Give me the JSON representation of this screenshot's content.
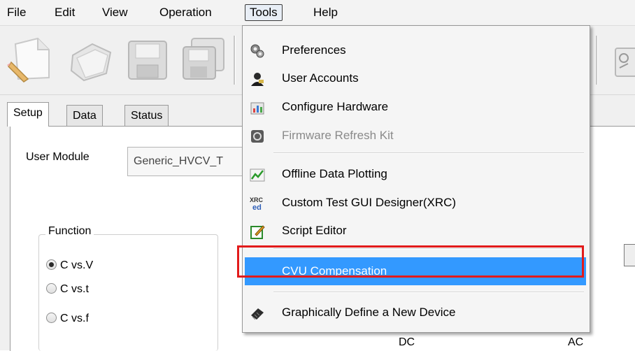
{
  "menubar": {
    "items": [
      "File",
      "Edit",
      "View",
      "Operation",
      "Tools",
      "Help"
    ],
    "active": "Tools"
  },
  "toolbar": {
    "icons": [
      "new-document-icon",
      "open-folder-icon",
      "save-icon",
      "save-all-icon",
      "settings-icon"
    ]
  },
  "tabs": [
    "Setup",
    "Data",
    "Status"
  ],
  "setup": {
    "user_module_label": "User Module",
    "user_module_value": "Generic_HVCV_T",
    "function_group_title": "Function",
    "function_options": [
      "C vs.V",
      "C vs.t",
      "C vs.f"
    ],
    "function_selected": "C vs.V",
    "dc_label": "DC",
    "ac_label": "AC"
  },
  "tools_menu": {
    "items": [
      {
        "label": "Preferences",
        "icon": "preferences-icon",
        "enabled": true
      },
      {
        "label": "User Accounts",
        "icon": "user-accounts-icon",
        "enabled": true
      },
      {
        "label": "Configure Hardware",
        "icon": "configure-hardware-icon",
        "enabled": true
      },
      {
        "label": "Firmware Refresh Kit",
        "icon": "firmware-icon",
        "enabled": false
      },
      {
        "label": "Offline Data Plotting",
        "icon": "plot-icon",
        "enabled": true
      },
      {
        "label": "Custom Test GUI Designer(XRC)",
        "icon": "xrced-icon",
        "enabled": true
      },
      {
        "label": "Script Editor",
        "icon": "script-editor-icon",
        "enabled": true
      },
      {
        "label": "CVU Compensation",
        "icon": "",
        "enabled": true,
        "highlighted": true
      },
      {
        "label": "Graphically Define a New Device",
        "icon": "device-icon",
        "enabled": true
      }
    ],
    "xrc_badge_top": "XRC",
    "xrc_badge_bottom": "ed"
  },
  "colors": {
    "highlight": "#3399ff",
    "annotation_box": "#e21b1b"
  }
}
